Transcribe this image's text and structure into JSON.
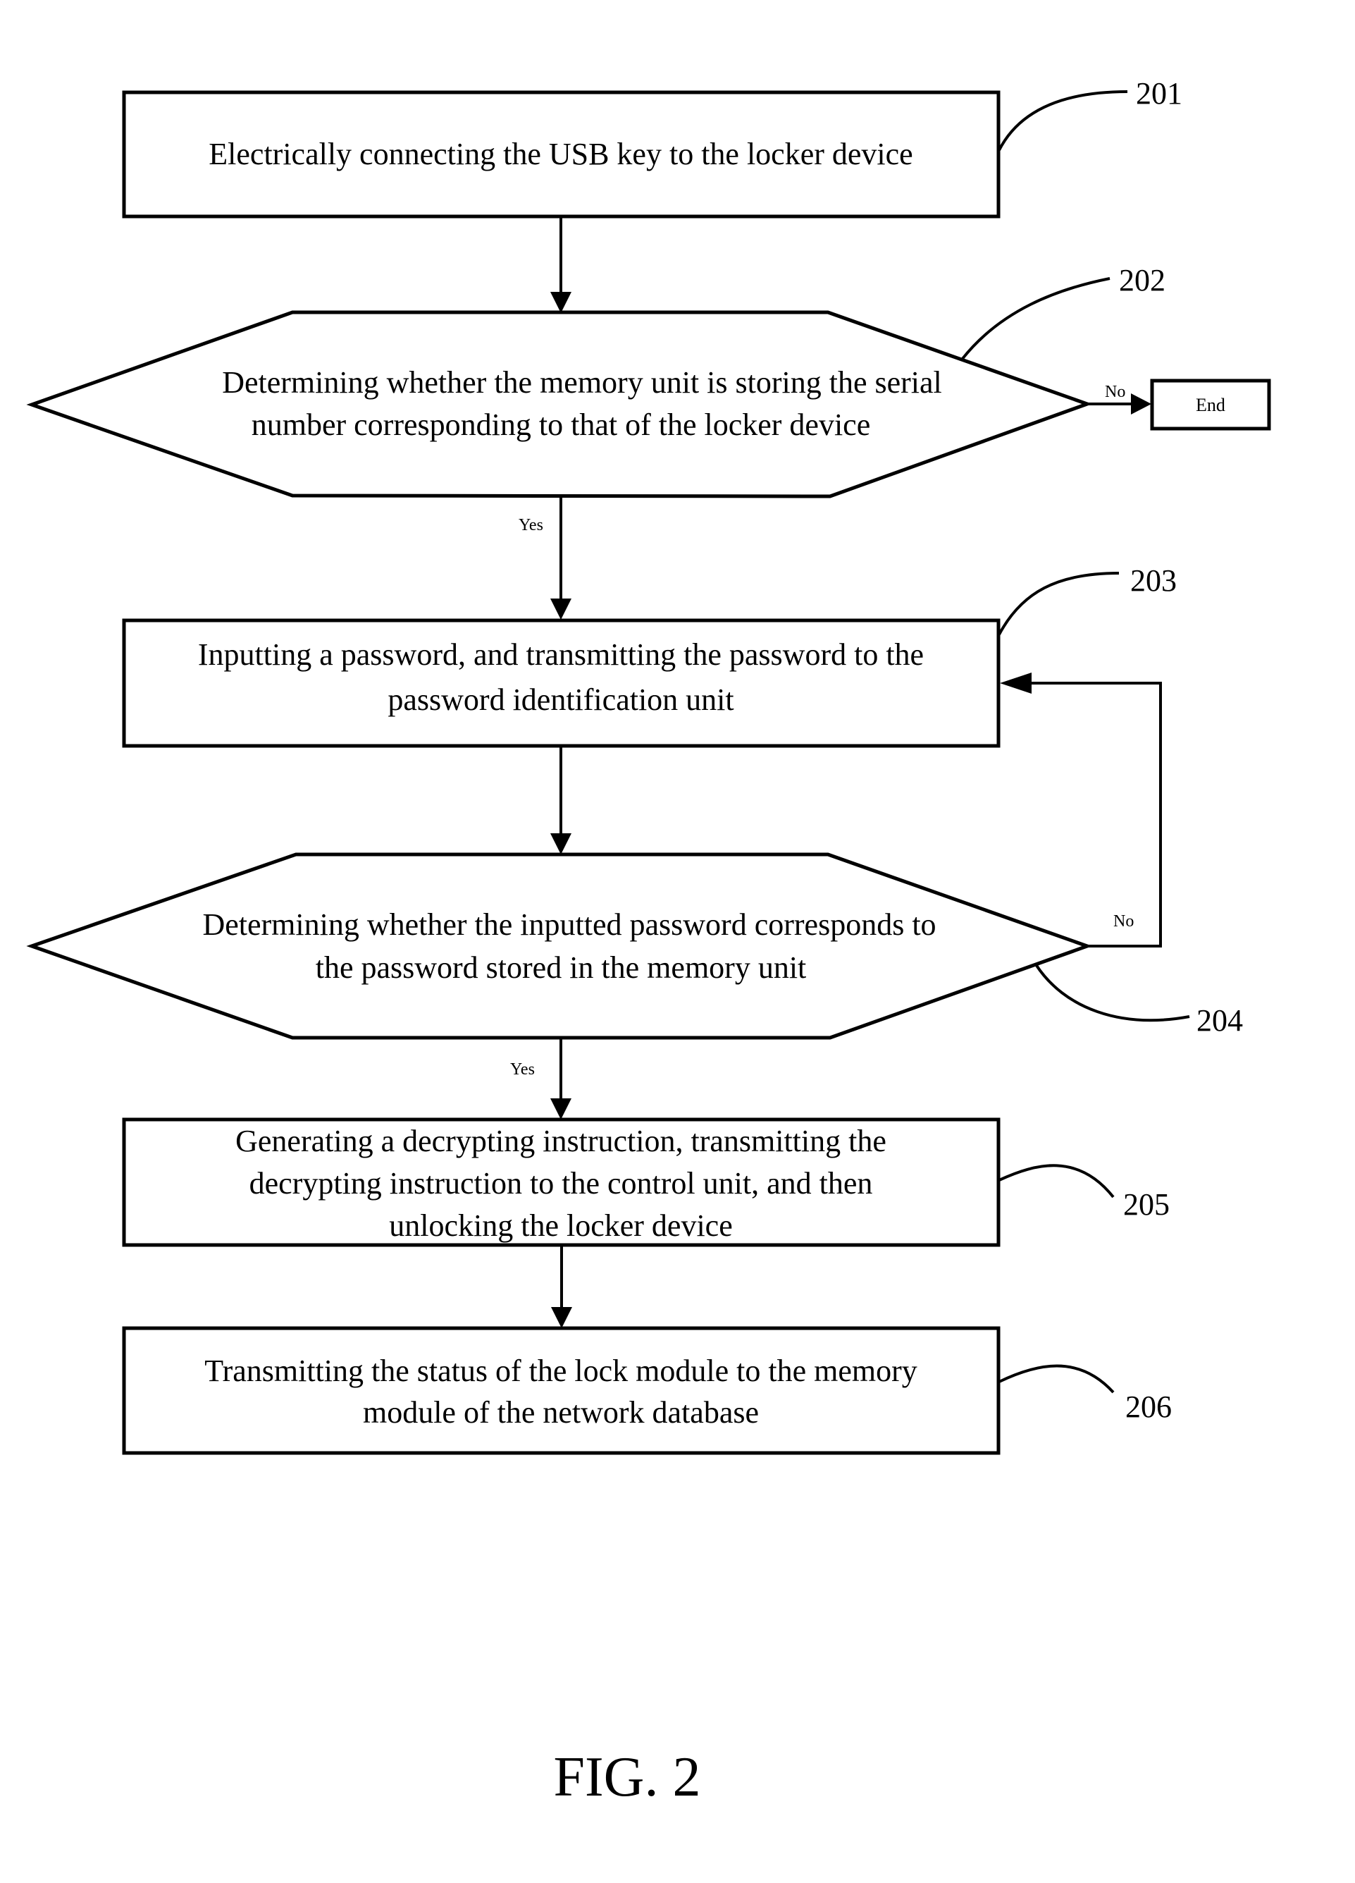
{
  "figure": {
    "caption": "FIG. 2",
    "colors": {
      "line": "#000000",
      "background": "#ffffff"
    }
  },
  "nodes": {
    "step_201": {
      "ref": "201",
      "type": "process",
      "lines": [
        "Electrically connecting the USB key to the locker device"
      ]
    },
    "step_202": {
      "ref": "202",
      "type": "decision",
      "lines": [
        "Determining whether the memory unit is storing the serial",
        "number corresponding to that of the locker device"
      ]
    },
    "step_203": {
      "ref": "203",
      "type": "process",
      "lines": [
        "Inputting a password, and transmitting the password to the",
        "password identification unit"
      ]
    },
    "step_204": {
      "ref": "204",
      "type": "decision",
      "lines": [
        "Determining whether the inputted password corresponds to",
        "the password stored in the memory unit"
      ]
    },
    "step_205": {
      "ref": "205",
      "type": "process",
      "lines": [
        "Generating a decrypting instruction, transmitting the",
        "decrypting instruction to the control unit, and then",
        "unlocking the locker device"
      ]
    },
    "step_206": {
      "ref": "206",
      "type": "process",
      "lines": [
        "Transmitting the status of the lock module to the memory",
        "module of the network database"
      ]
    },
    "end": {
      "type": "terminal",
      "label": "End"
    }
  },
  "edges": {
    "e_201_202": {
      "from": "201",
      "to": "202",
      "label": ""
    },
    "e_202_end": {
      "from": "202",
      "to": "End",
      "label": "No"
    },
    "e_202_203": {
      "from": "202",
      "to": "203",
      "label": "Yes"
    },
    "e_203_204": {
      "from": "203",
      "to": "204",
      "label": ""
    },
    "e_204_203": {
      "from": "204",
      "to": "203",
      "label": "No"
    },
    "e_204_205": {
      "from": "204",
      "to": "205",
      "label": "Yes"
    },
    "e_205_206": {
      "from": "205",
      "to": "206",
      "label": ""
    }
  }
}
